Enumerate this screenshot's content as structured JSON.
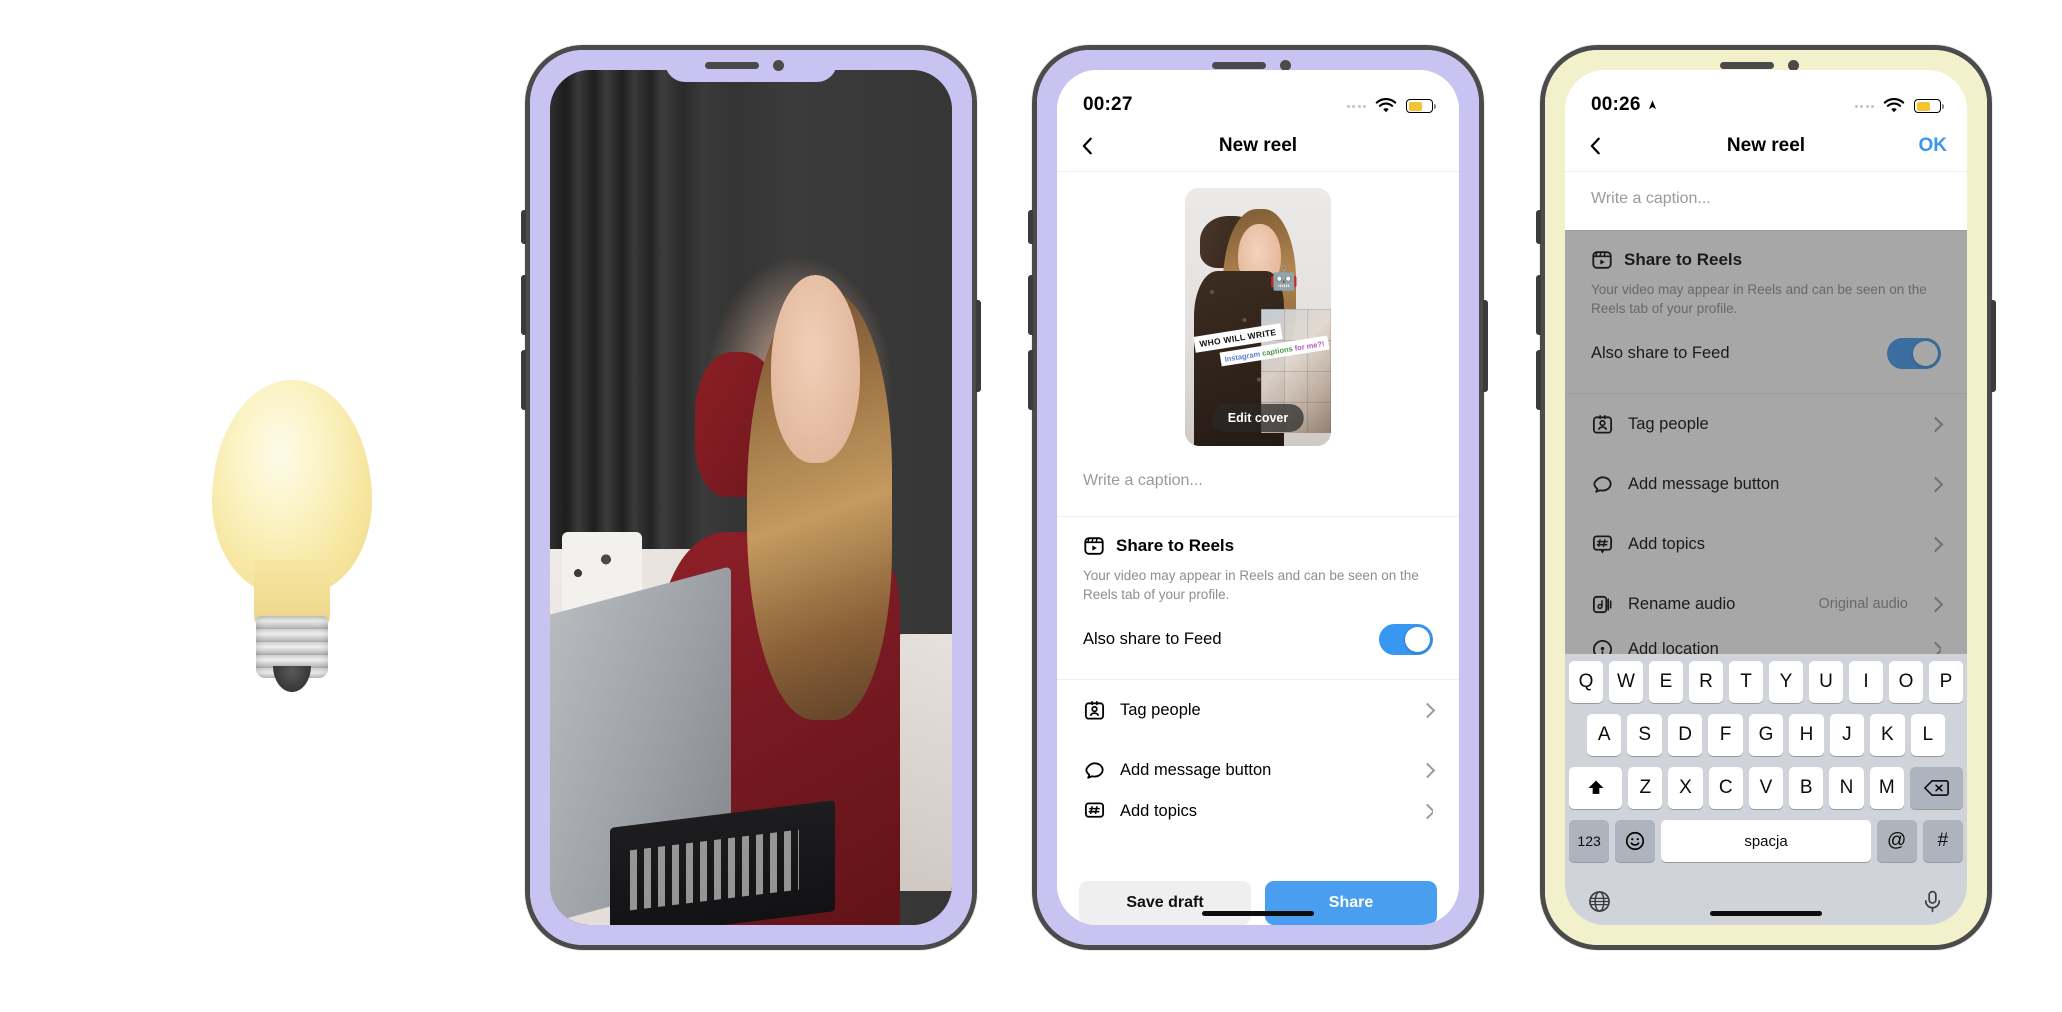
{
  "scene": {
    "background_color": "#ffffff",
    "decor_icon": "lightbulb-emoji"
  },
  "phone1": {
    "bezel_color": "#c9c3f2",
    "content": "photo-woman-in-red-dress-with-laptop"
  },
  "phone2": {
    "bezel_color": "#c9c3f2",
    "statusbar": {
      "time": "00:27",
      "wifi_icon": "wifi-icon",
      "battery_icon": "battery-icon",
      "signal_icon": "signal-dots-icon"
    },
    "navbar": {
      "back_icon": "chevron-left-icon",
      "title": "New reel"
    },
    "cover": {
      "edit_label": "Edit cover",
      "sticker_line1": "WHO WILL WRITE",
      "sticker_line2_a": "Instagram ",
      "sticker_line2_b": "captions ",
      "sticker_line2_c": "for me?!",
      "robot_emoji": "robot-emoji"
    },
    "caption": {
      "placeholder": "Write a caption..."
    },
    "share_section": {
      "icon": "reels-icon",
      "title": "Share to Reels",
      "description": "Your video may appear in Reels and can be seen on the Reels tab of your profile.",
      "toggle_label": "Also share to Feed",
      "toggle_on": true,
      "toggle_color": "#3897f0"
    },
    "list_rows": [
      {
        "icon": "tag-people-icon",
        "label": "Tag people",
        "value": "",
        "chevron": "chevron-right-icon"
      },
      {
        "icon": "message-bubble-icon",
        "label": "Add message button",
        "value": "",
        "chevron": "chevron-right-icon"
      },
      {
        "icon": "hashtag-icon",
        "label": "Add topics",
        "value": "",
        "chevron": "chevron-right-icon"
      }
    ],
    "footer": {
      "save_label": "Save draft",
      "share_label": "Share",
      "share_color": "#4a9ef0"
    }
  },
  "phone3": {
    "bezel_color": "#f2f1cb",
    "statusbar": {
      "time": "00:26",
      "location_icon": "location-arrow-icon",
      "wifi_icon": "wifi-icon",
      "battery_icon": "battery-icon",
      "signal_icon": "signal-dots-icon"
    },
    "navbar": {
      "back_icon": "chevron-left-icon",
      "title": "New reel",
      "ok_label": "OK",
      "ok_color": "#3897f0"
    },
    "caption": {
      "placeholder": "Write a caption..."
    },
    "share_section": {
      "icon": "reels-icon",
      "title": "Share to Reels",
      "description": "Your video may appear in Reels and can be seen on the Reels tab of your profile.",
      "toggle_label": "Also share to Feed",
      "toggle_on": true,
      "toggle_color": "#3897f0"
    },
    "list_rows": [
      {
        "icon": "tag-people-icon",
        "label": "Tag people",
        "value": "",
        "chevron": "chevron-right-icon"
      },
      {
        "icon": "message-bubble-icon",
        "label": "Add message button",
        "value": "",
        "chevron": "chevron-right-icon"
      },
      {
        "icon": "hashtag-icon",
        "label": "Add topics",
        "value": "",
        "chevron": "chevron-right-icon"
      },
      {
        "icon": "audio-note-icon",
        "label": "Rename audio",
        "value": "Original audio",
        "chevron": "chevron-right-icon"
      },
      {
        "icon": "location-pin-icon",
        "label": "Add location",
        "value": "",
        "chevron": "chevron-right-icon"
      }
    ],
    "keyboard": {
      "language": "polish",
      "row1": [
        "Q",
        "W",
        "E",
        "R",
        "T",
        "Y",
        "U",
        "I",
        "O",
        "P"
      ],
      "row2": [
        "A",
        "S",
        "D",
        "F",
        "G",
        "H",
        "J",
        "K",
        "L"
      ],
      "row3": [
        "Z",
        "X",
        "C",
        "V",
        "B",
        "N",
        "M"
      ],
      "shift_icon": "shift-up-arrow-icon",
      "backspace_icon": "backspace-icon",
      "numbers_label": "123",
      "emoji_icon": "smiley-face-icon",
      "space_label": "spacja",
      "at_label": "@",
      "hash_label": "#",
      "globe_icon": "globe-icon",
      "mic_icon": "microphone-icon"
    }
  }
}
